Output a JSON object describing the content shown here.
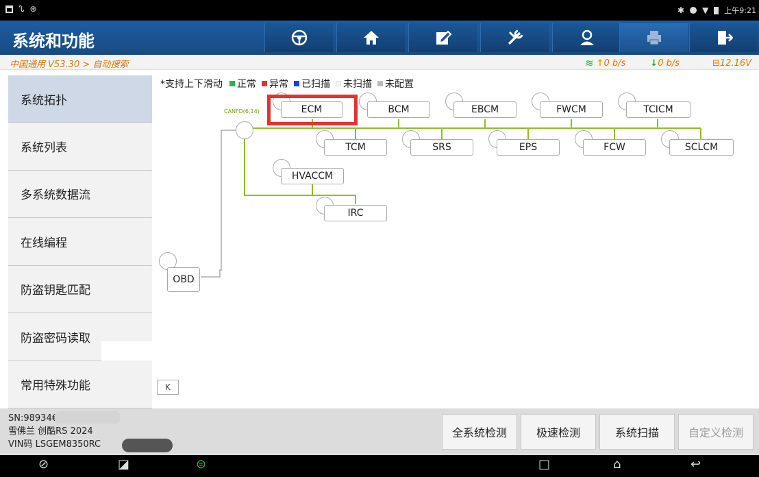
{
  "app": {
    "title": "系统和功能"
  },
  "toolbar": [
    {
      "name": "steering-wheel-icon"
    },
    {
      "name": "home-icon"
    },
    {
      "name": "edit-icon"
    },
    {
      "name": "tools-icon"
    },
    {
      "name": "user-icon"
    },
    {
      "name": "print-icon"
    },
    {
      "name": "exit-icon"
    }
  ],
  "breadcrumb": "中国通用 V53.30 > 自动搜索",
  "network": {
    "up": "0 b/s",
    "down": "0 b/s",
    "voltage": "12.16V"
  },
  "status_bar": {
    "time": "上午9:21"
  },
  "sidebar": {
    "items": [
      {
        "label": "系统拓扑"
      },
      {
        "label": "系统列表"
      },
      {
        "label": "多系统数据流"
      },
      {
        "label": "在线编程"
      },
      {
        "label": "防盗钥匙匹配"
      },
      {
        "label": "防盗密码读取"
      },
      {
        "label": "常用特殊功能"
      }
    ]
  },
  "legend": {
    "prefix": "*支持上下滑动",
    "normal": "正常",
    "abnormal": "异常",
    "scanned": "已扫描",
    "unscanned": "未扫描",
    "unconfigured": "未配置",
    "colors": {
      "normal": "#2fb24a",
      "abnormal": "#e2342f",
      "scanned": "#1f3fd6",
      "unscanned": "#eeeeee",
      "unconfigured": "#bbbbbb"
    }
  },
  "topology": {
    "bus_label": "CANFD(6,14)",
    "bus_color": "#8cbf26",
    "root": "OBD",
    "modules": {
      "ecm": "ECM",
      "bcm": "BCM",
      "ebcm": "EBCM",
      "fwcm": "FWCM",
      "tcicm": "TCICM",
      "tcm": "TCM",
      "srs": "SRS",
      "eps": "EPS",
      "fcw": "FCW",
      "sclcm": "SCLCM",
      "hvaccm": "HVACCM",
      "irc": "IRC"
    },
    "highlighted": "ECM"
  },
  "vehicle": {
    "sn": "SN:98934€",
    "model": "雪佛兰 创酷RS 2024",
    "vin": "VIN码 LSGEM8350RC"
  },
  "actions": {
    "full_check": "全系统检测",
    "quick_check": "极速检测",
    "system_scan": "系统扫描",
    "custom_check": "自定义检测"
  },
  "collapse_label": "K"
}
